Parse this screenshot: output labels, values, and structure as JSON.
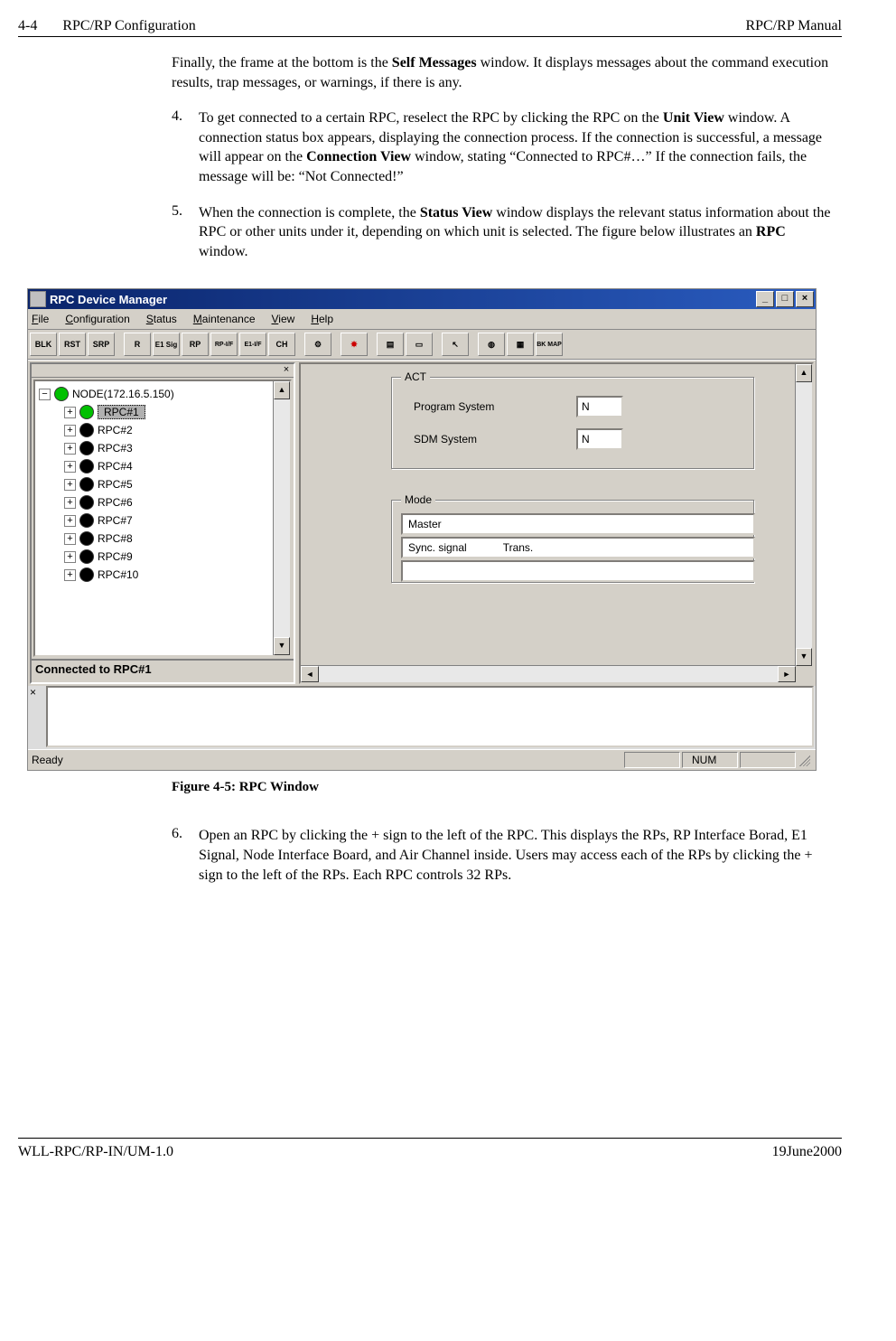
{
  "header": {
    "left_num": "4-4",
    "left_title": "RPC/RP Configuration",
    "right": "RPC/RP Manual"
  },
  "footer": {
    "left": "WLL-RPC/RP-IN/UM-1.0",
    "right": "19June2000"
  },
  "body": {
    "intro1_a": "Finally, the frame at the bottom is the ",
    "intro1_bold": "Self Messages",
    "intro1_b": " window.  It displays messages about the command execution results, trap messages, or warnings, if there is any.",
    "item4_num": "4.",
    "item4_a": "To get connected to a certain RPC, reselect the RPC by clicking the RPC on the ",
    "item4_b1": "Unit View",
    "item4_c": " window.  A connection status box appears, displaying the connection process.  If the connection is successful, a message will appear on the ",
    "item4_b2": "Connection View",
    "item4_d": " window, stating “Connected to RPC#…” If the connection fails, the message will be: “Not Connected!”",
    "item5_num": "5.",
    "item5_a": "When the connection is complete, the ",
    "item5_b1": "Status View",
    "item5_c": " window displays the relevant status information about the RPC or other units under it, depending on which unit is selected.  The figure below illustrates an ",
    "item5_b2": "RPC",
    "item5_d": " window.",
    "figcap": "Figure 4-5: RPC Window",
    "item6_num": "6.",
    "item6_txt": "Open an RPC by clicking the + sign to the left of the RPC.  This displays the RPs, RP Interface Borad, E1 Signal, Node Interface Board, and Air Channel inside.  Users may access each of the RPs by clicking the + sign to the left of the RPs.  Each RPC controls 32 RPs."
  },
  "app": {
    "title": "RPC Device Manager",
    "menu": {
      "file": "File",
      "configuration": "Configuration",
      "status": "Status",
      "maintenance": "Maintenance",
      "view": "View",
      "help": "Help"
    },
    "menu_ul": {
      "file": "F",
      "configuration": "C",
      "status": "S",
      "maintenance": "M",
      "view": "V",
      "help": "H"
    },
    "toolbar": [
      "BLK",
      "RST",
      "SRP",
      "R",
      "E1 Sig",
      "RP",
      "RP-I/F",
      "E1-I/F",
      "CH",
      "",
      "",
      "",
      "",
      "",
      "",
      "",
      ""
    ],
    "tree": {
      "root": "NODE(172.16.5.150)",
      "items": [
        {
          "label": "RPC#1",
          "color": "green",
          "selected": true
        },
        {
          "label": "RPC#2",
          "color": "black"
        },
        {
          "label": "RPC#3",
          "color": "black"
        },
        {
          "label": "RPC#4",
          "color": "black"
        },
        {
          "label": "RPC#5",
          "color": "black"
        },
        {
          "label": "RPC#6",
          "color": "black"
        },
        {
          "label": "RPC#7",
          "color": "black"
        },
        {
          "label": "RPC#8",
          "color": "black"
        },
        {
          "label": "RPC#9",
          "color": "black"
        },
        {
          "label": "RPC#10",
          "color": "black"
        }
      ],
      "status": "Connected to RPC#1"
    },
    "right": {
      "act_legend": "ACT",
      "prog_label": "Program System",
      "sdm_label": "SDM System",
      "prog_val": "N",
      "sdm_val": "N",
      "mode_legend": "Mode",
      "mode_val": "Master",
      "sync_label": "Sync. signal",
      "trans_label": "Trans."
    },
    "statusbar": {
      "ready": "Ready",
      "num": "NUM"
    },
    "close_x": "×",
    "min": "_",
    "max": "□",
    "close": "×",
    "up": "▲",
    "down": "▼",
    "left_arr": "◄",
    "right_arr": "►",
    "minus": "−",
    "plus": "+"
  }
}
